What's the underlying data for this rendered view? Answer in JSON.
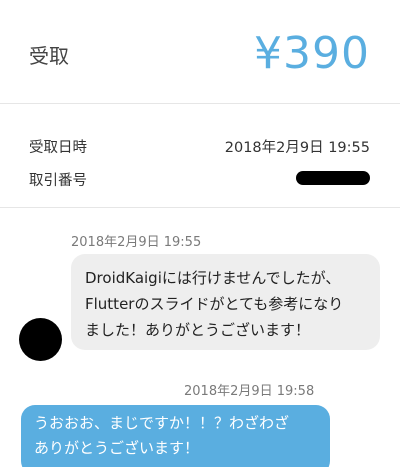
{
  "header": {
    "label": "受取",
    "amount": "¥390"
  },
  "details": {
    "received_at_label": "受取日時",
    "received_at_value": "2018年2月9日 19:55",
    "transaction_id_label": "取引番号"
  },
  "chat": {
    "messages": [
      {
        "direction": "incoming",
        "timestamp": "2018年2月9日 19:55",
        "lines": [
          "DroidKaigiには行けませんでしたが、",
          "Flutterのスライドがとても参考になり",
          "ました！ありがとうございます！"
        ]
      },
      {
        "direction": "outgoing",
        "timestamp": "2018年2月9日 19:58",
        "lines": [
          "うおおお、まじですか！！？わざわざ",
          "ありがとうございます！"
        ]
      }
    ]
  },
  "colors": {
    "accent": "#5aaee0",
    "incoming_bubble": "#eeeeee",
    "divider": "#e6e6e6"
  }
}
